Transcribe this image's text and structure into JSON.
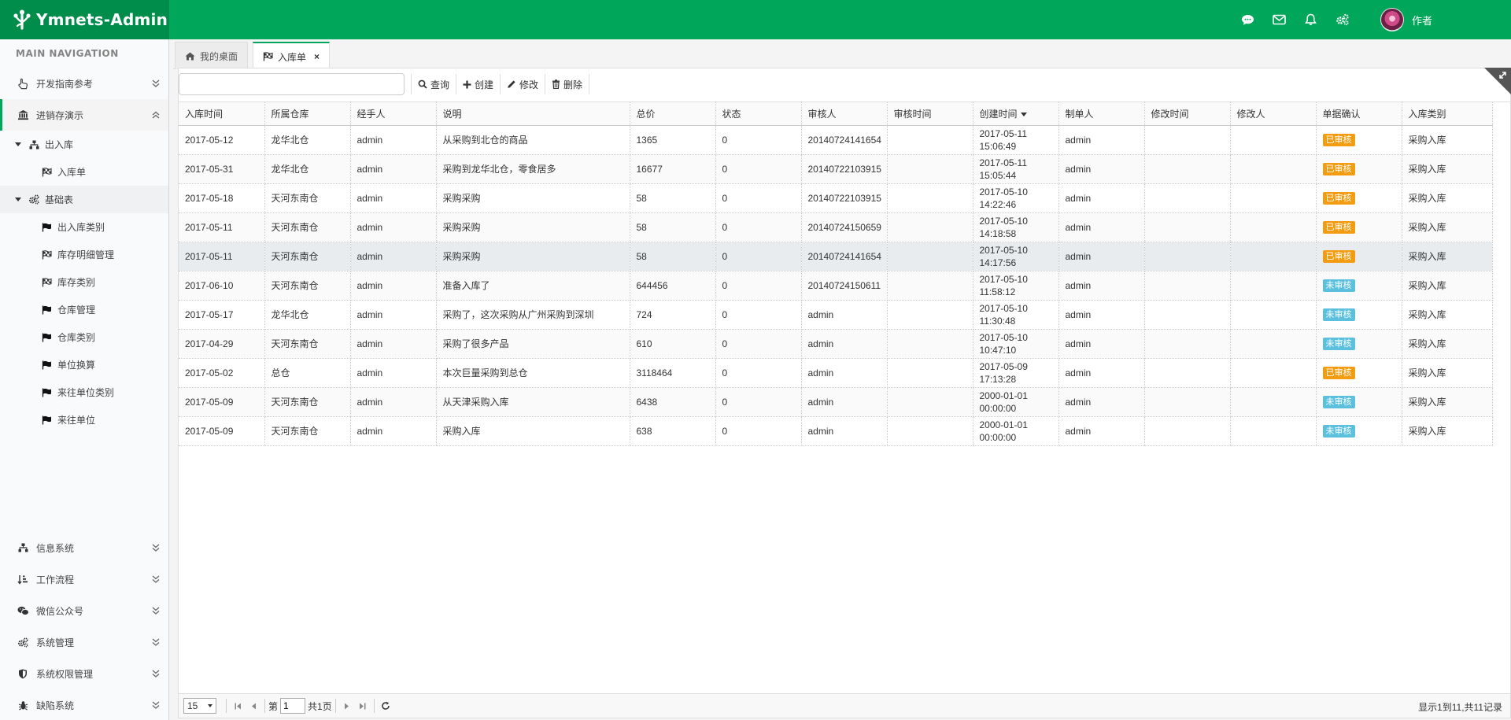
{
  "app": {
    "title": "Ymnets-Admin"
  },
  "header": {
    "user_name": "作者"
  },
  "sidebar": {
    "header": "MAIN NAVIGATION",
    "top_items": [
      {
        "label": "开发指南参考"
      },
      {
        "label": "进销存演示"
      }
    ],
    "group1": {
      "label": "出入库"
    },
    "group1_items": [
      {
        "label": "入库单"
      }
    ],
    "group2": {
      "label": "基础表"
    },
    "group2_items": [
      {
        "label": "出入库类别"
      },
      {
        "label": "库存明细管理"
      },
      {
        "label": "库存类别"
      },
      {
        "label": "仓库管理"
      },
      {
        "label": "仓库类别"
      },
      {
        "label": "单位换算"
      },
      {
        "label": "来往单位类别"
      },
      {
        "label": "来往单位"
      }
    ],
    "bottom_items": [
      {
        "label": "信息系统"
      },
      {
        "label": "工作流程"
      },
      {
        "label": "微信公众号"
      },
      {
        "label": "系统管理"
      },
      {
        "label": "系统权限管理"
      },
      {
        "label": "缺陷系统"
      }
    ]
  },
  "tabs": [
    {
      "label": "我的桌面"
    },
    {
      "label": "入库单",
      "close": "×"
    }
  ],
  "toolbar": {
    "search_value": "",
    "query": "查询",
    "create": "创建",
    "edit": "修改",
    "delete": "删除"
  },
  "table": {
    "columns": [
      "入库时间",
      "所属仓库",
      "经手人",
      "说明",
      "总价",
      "状态",
      "审核人",
      "审核时间",
      "创建时间",
      "制单人",
      "修改时间",
      "修改人",
      "单据确认",
      "入库类别"
    ],
    "rows": [
      [
        "2017-05-12",
        "龙华北仓",
        "admin",
        "从采购到北仓的商品",
        "1365",
        "0",
        "20140724141654",
        "",
        "2017-05-11 15:06:49",
        "admin",
        "",
        "",
        "已审核",
        "采购入库"
      ],
      [
        "2017-05-31",
        "龙华北仓",
        "admin",
        "采购到龙华北仓，零食居多",
        "16677",
        "0",
        "20140722103915",
        "",
        "2017-05-11 15:05:44",
        "admin",
        "",
        "",
        "已审核",
        "采购入库"
      ],
      [
        "2017-05-18",
        "天河东南仓",
        "admin",
        "采购采购",
        "58",
        "0",
        "20140722103915",
        "",
        "2017-05-10 14:22:46",
        "admin",
        "",
        "",
        "已审核",
        "采购入库"
      ],
      [
        "2017-05-11",
        "天河东南仓",
        "admin",
        "采购采购",
        "58",
        "0",
        "20140724150659",
        "",
        "2017-05-10 14:18:58",
        "admin",
        "",
        "",
        "已审核",
        "采购入库"
      ],
      [
        "2017-05-11",
        "天河东南仓",
        "admin",
        "采购采购",
        "58",
        "0",
        "20140724141654",
        "",
        "2017-05-10 14:17:56",
        "admin",
        "",
        "",
        "已审核",
        "采购入库"
      ],
      [
        "2017-06-10",
        "天河东南仓",
        "admin",
        "准备入库了",
        "644456",
        "0",
        "20140724150611",
        "",
        "2017-05-10 11:58:12",
        "admin",
        "",
        "",
        "未审核",
        "采购入库"
      ],
      [
        "2017-05-17",
        "龙华北仓",
        "admin",
        "采购了，这次采购从广州采购到深圳",
        "724",
        "0",
        "admin",
        "",
        "2017-05-10 11:30:48",
        "admin",
        "",
        "",
        "未审核",
        "采购入库"
      ],
      [
        "2017-04-29",
        "天河东南仓",
        "admin",
        "采购了很多产品",
        "610",
        "0",
        "admin",
        "",
        "2017-05-10 10:47:10",
        "admin",
        "",
        "",
        "未审核",
        "采购入库"
      ],
      [
        "2017-05-02",
        "总仓",
        "admin",
        "本次巨量采购到总仓",
        "3118464",
        "0",
        "admin",
        "",
        "2017-05-09 17:13:28",
        "admin",
        "",
        "",
        "已审核",
        "采购入库"
      ],
      [
        "2017-05-09",
        "天河东南仓",
        "admin",
        "从天津采购入库",
        "6438",
        "0",
        "admin",
        "",
        "2000-01-01 00:00:00",
        "admin",
        "",
        "",
        "未审核",
        "采购入库"
      ],
      [
        "2017-05-09",
        "天河东南仓",
        "admin",
        "采购入库",
        "638",
        "0",
        "admin",
        "",
        "2000-01-01 00:00:00",
        "admin",
        "",
        "",
        "未审核",
        "采购入库"
      ]
    ]
  },
  "pager": {
    "page_size": "15",
    "page_prefix": "第",
    "page_value": "1",
    "page_total": "共1页",
    "info": "显示1到11,共11记录"
  },
  "colors": {
    "header_green": "#00a65a",
    "brand_green": "#008d4c",
    "approved_badge": "#f39c12",
    "pending_badge": "#5bc0de"
  }
}
